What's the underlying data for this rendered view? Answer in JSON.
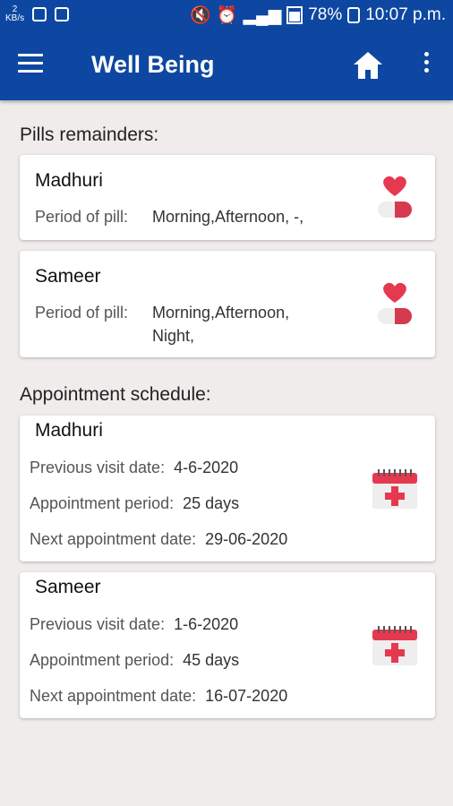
{
  "status_bar": {
    "left_data": "2",
    "left_unit": "KB/s",
    "battery": "78%",
    "time": "10:07 p.m."
  },
  "app_bar": {
    "title": "Well Being",
    "menu_icon": "menu-icon",
    "home_icon": "home-icon",
    "more_icon": "more-vert-icon"
  },
  "pills": {
    "title": "Pills remainders:",
    "label": "Period of pill:",
    "items": [
      {
        "name": "Madhuri",
        "periods_line1": "Morning,Afternoon,   -,",
        "periods_line2": ""
      },
      {
        "name": "Sameer",
        "periods_line1": "Morning,Afternoon,",
        "periods_line2": "Night,"
      }
    ]
  },
  "appointments": {
    "title": "Appointment schedule:",
    "prev_label": "Previous visit date:",
    "period_label": "Appointment period:",
    "next_label": "Next appointment date:",
    "items": [
      {
        "name": "Madhuri",
        "previous": "4-6-2020",
        "period": "25 days",
        "next": "29-06-2020"
      },
      {
        "name": "Sameer",
        "previous": "1-6-2020",
        "period": "45 days",
        "next": "16-07-2020"
      }
    ]
  },
  "colors": {
    "primary": "#0d47a1",
    "background": "#efeceb",
    "heart": "#e53950",
    "calendar": "#e53950"
  }
}
